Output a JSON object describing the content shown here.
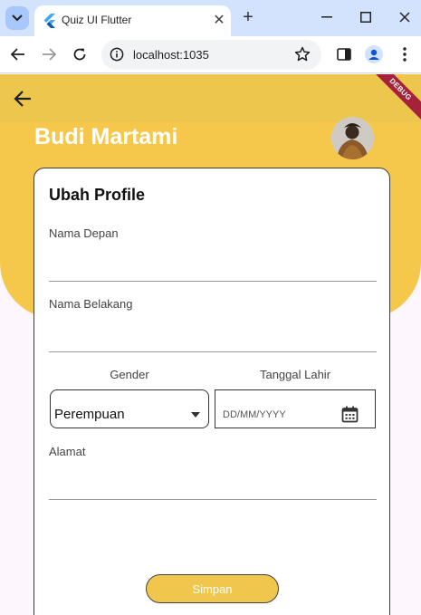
{
  "browser": {
    "tab_title": "Quiz UI Flutter",
    "url": "localhost:1035"
  },
  "app": {
    "debug_banner": "DEBUG",
    "user_name": "Budi Martami",
    "form": {
      "title": "Ubah Profile",
      "first_name_label": "Nama Depan",
      "first_name_value": "",
      "last_name_label": "Nama Belakang",
      "last_name_value": "",
      "gender_label": "Gender",
      "gender_value": "Perempuan",
      "birthdate_label": "Tanggal Lahir",
      "birthdate_placeholder": "DD/MM/YYYY",
      "address_label": "Alamat",
      "address_value": "",
      "save_label": "Simpan"
    }
  },
  "colors": {
    "primary_yellow": "#f5c84c",
    "appbar_yellow": "#edc64e",
    "button_yellow": "#f0c64c",
    "debug_red": "#a4223a",
    "page_bg": "#fdf7fd"
  }
}
